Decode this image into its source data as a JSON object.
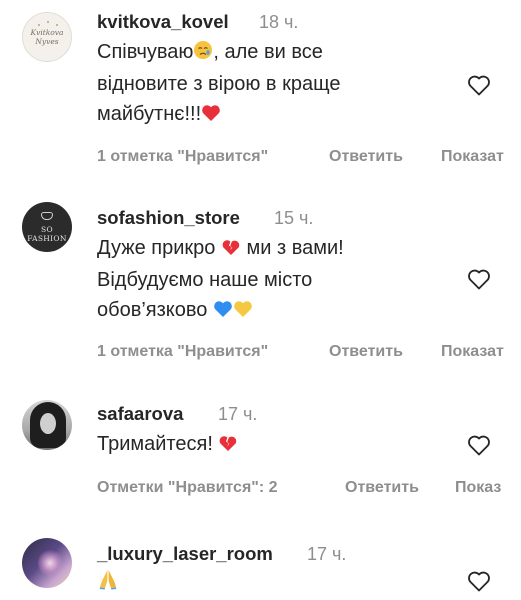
{
  "comments": [
    {
      "username": "kvitkova_kovel",
      "time": "18 ч.",
      "lines": [
        "Співчуваю",
        ", але ви все",
        "відновите з вірою в краще",
        "майбутнє!!!"
      ],
      "emoji": [
        "crying-face",
        "red-heart"
      ],
      "likes_label": "1 отметка \"Нравится\"",
      "reply_label": "Ответить",
      "more_label": "Показат",
      "avatar_text": "Kvitkova Nyves"
    },
    {
      "username": "sofashion_store",
      "time": "15 ч.",
      "lines": [
        "Дуже прикро",
        " ми з вами!",
        "Відбудуємо наше місто",
        "обов’язково"
      ],
      "emoji": [
        "broken-heart",
        "blue-heart",
        "yellow-heart"
      ],
      "likes_label": "1 отметка \"Нравится\"",
      "reply_label": "Ответить",
      "more_label": "Показат",
      "avatar_text": "SO FASHION"
    },
    {
      "username": "safaarova",
      "time": "17 ч.",
      "lines": [
        "Тримайтеся!"
      ],
      "emoji": [
        "broken-heart"
      ],
      "likes_label": "Отметки \"Нравится\": 2",
      "reply_label": "Ответить",
      "more_label": "Показ"
    },
    {
      "username": "_luxury_laser_room",
      "time": "17 ч.",
      "lines": [],
      "emoji": [
        "folded-hands"
      ]
    }
  ],
  "colors": {
    "text": "#262626",
    "secondary": "#8e8e8e",
    "heart": "#e0245e"
  }
}
